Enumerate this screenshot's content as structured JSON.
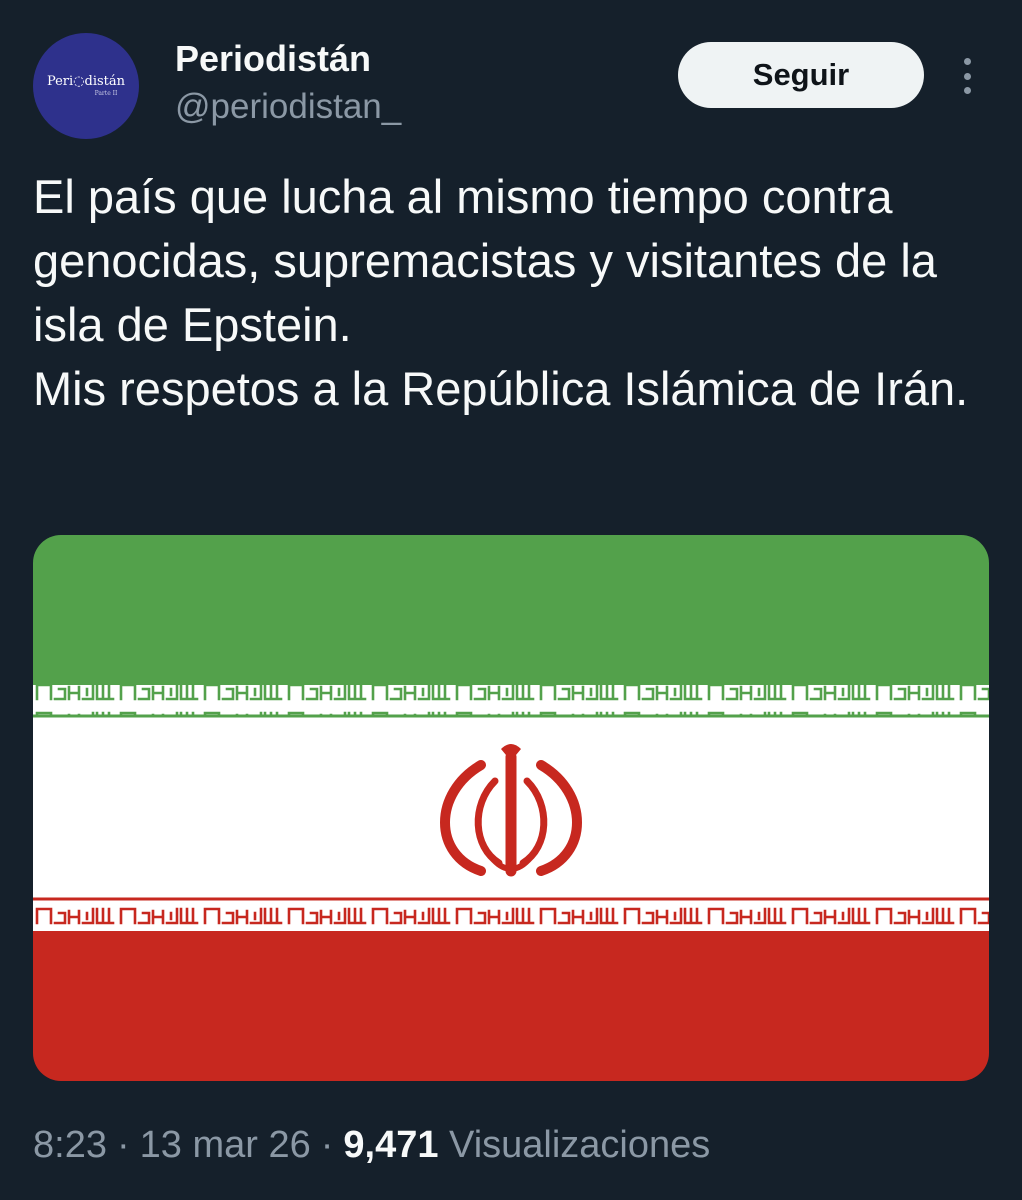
{
  "tweet": {
    "author": {
      "display_name": "Periodistán",
      "handle": "@periodistan_",
      "avatar_logo_text": "Peri◌distán",
      "avatar_sub_text": "Parte II"
    },
    "follow_button_label": "Seguir",
    "text_lines": [
      "El país que lucha al mismo tiempo contra genocidas, supremacistas y visitantes de la isla de Epstein.",
      "Mis respetos a la República Islámica de Irán."
    ],
    "media": {
      "description": "flag-of-iran",
      "colors": {
        "green": "#53a14b",
        "white": "#ffffff",
        "red": "#c7281f"
      }
    },
    "meta": {
      "time": "8:23",
      "separator": "·",
      "date": "13 mar 26",
      "views_count": "9,471",
      "views_label": "Visualizaciones"
    }
  },
  "colors": {
    "background": "#15202b",
    "text_primary": "#f7f9f9",
    "text_secondary": "#8b98a5",
    "button_bg": "#eff3f4",
    "avatar_bg": "#2e318c"
  }
}
